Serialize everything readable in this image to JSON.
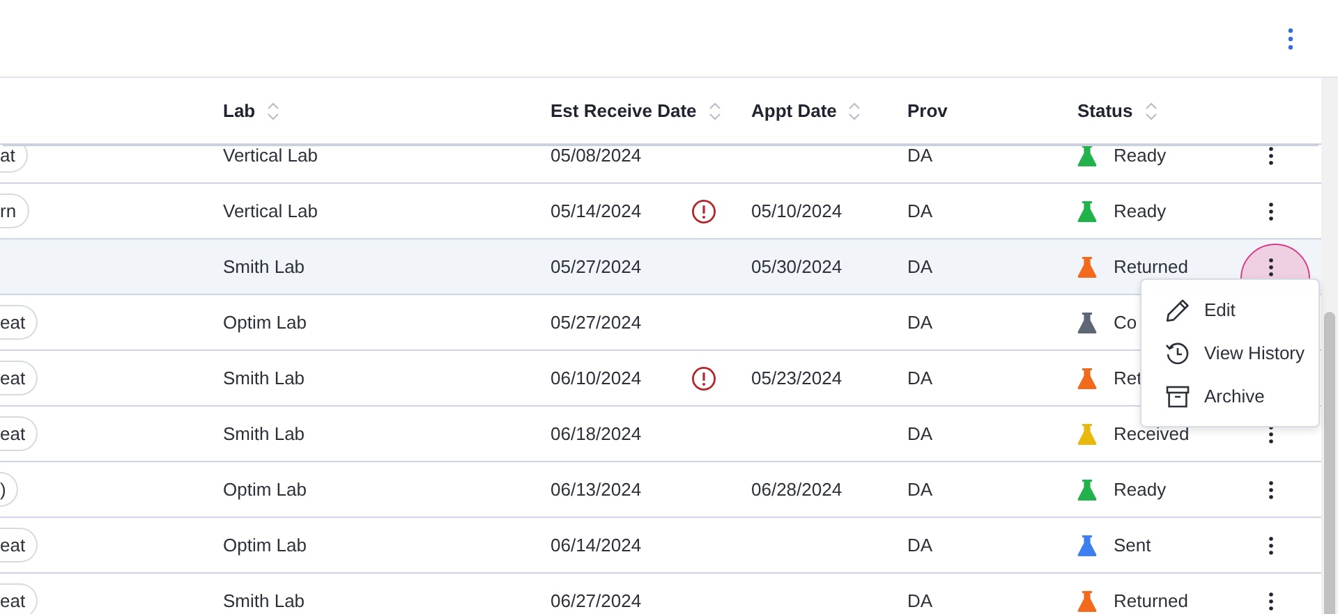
{
  "top_bar": {
    "more_button": true
  },
  "table": {
    "columns": [
      {
        "label": "Lab",
        "sortable": true
      },
      {
        "label": "Est Receive Date",
        "sortable": true
      },
      {
        "label": "Appt Date",
        "sortable": true
      },
      {
        "label": "Prov",
        "sortable": false
      },
      {
        "label": "Status",
        "sortable": true
      }
    ],
    "rows": [
      {
        "tag": "at",
        "lab": "Vertical Lab",
        "est_receive_date": "05/08/2024",
        "alert": false,
        "prov": "DA",
        "status": "Ready",
        "color": "#22b24c",
        "selected": false,
        "menu_open": false
      },
      {
        "tag": "rn",
        "lab": "Vertical Lab",
        "est_receive_date": "05/14/2024",
        "alert": true,
        "appt_date": "05/10/2024",
        "prov": "DA",
        "status": "Ready",
        "color": "#22b24c",
        "selected": false,
        "menu_open": false
      },
      {
        "lab": "Smith Lab",
        "est_receive_date": "05/27/2024",
        "alert": false,
        "appt_date": "05/30/2024",
        "prov": "DA",
        "status": "Returned",
        "color": "#f26b1d",
        "selected": true,
        "menu_open": true
      },
      {
        "tag": "eat",
        "lab": "Optim Lab",
        "est_receive_date": "05/27/2024",
        "alert": false,
        "prov": "DA",
        "status": "Co",
        "color": "#5d6778",
        "selected": false,
        "menu_open": false,
        "actions_hidden": true
      },
      {
        "tag": "eat",
        "lab": "Smith Lab",
        "est_receive_date": "06/10/2024",
        "alert": true,
        "appt_date": "05/23/2024",
        "prov": "DA",
        "status": "Ret",
        "color": "#f26b1d",
        "selected": false,
        "menu_open": false,
        "actions_hidden": true
      },
      {
        "tag": "eat",
        "lab": "Smith Lab",
        "est_receive_date": "06/18/2024",
        "alert": false,
        "prov": "DA",
        "status": "Received",
        "color": "#e8b90c",
        "selected": false,
        "menu_open": false
      },
      {
        "tag": ")",
        "lab": "Optim Lab",
        "est_receive_date": "06/13/2024",
        "alert": false,
        "appt_date": "06/28/2024",
        "prov": "DA",
        "status": "Ready",
        "color": "#22b24c",
        "selected": false,
        "menu_open": false
      },
      {
        "tag": "eat",
        "lab": "Optim Lab",
        "est_receive_date": "06/14/2024",
        "alert": false,
        "prov": "DA",
        "status": "Sent",
        "color": "#3b7ff0",
        "selected": false,
        "menu_open": false
      },
      {
        "tag": "eat",
        "lab": "Smith Lab",
        "est_receive_date": "06/27/2024",
        "alert": false,
        "prov": "DA",
        "status": "Returned",
        "color": "#f26b1d",
        "selected": false,
        "menu_open": false
      }
    ]
  },
  "row_menu": {
    "items": [
      {
        "label": "Edit",
        "kind": "edit"
      },
      {
        "label": "View History",
        "kind": "history"
      },
      {
        "label": "Archive",
        "kind": "archive"
      }
    ]
  }
}
